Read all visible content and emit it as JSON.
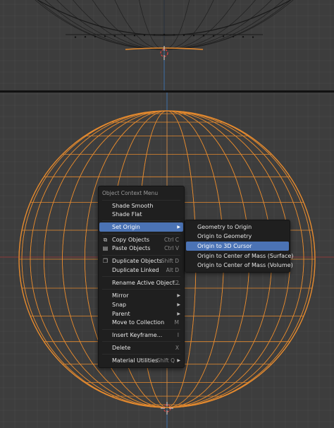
{
  "context_menu": {
    "title": "Object Context Menu",
    "items": [
      {
        "label": "Shade Smooth",
        "shortcut": ""
      },
      {
        "label": "Shade Flat",
        "shortcut": ""
      },
      {
        "label": "Set Origin",
        "shortcut": "",
        "submenu": true,
        "highlighted": true
      },
      {
        "label": "Copy Objects",
        "shortcut": "Ctrl C",
        "icon": "copy-icon"
      },
      {
        "label": "Paste Objects",
        "shortcut": "Ctrl V",
        "icon": "paste-icon"
      },
      {
        "label": "Duplicate Objects",
        "shortcut": "Shift D",
        "icon": "duplicate-icon"
      },
      {
        "label": "Duplicate Linked",
        "shortcut": "Alt D"
      },
      {
        "label": "Rename Active Object...",
        "shortcut": "F2"
      },
      {
        "label": "Mirror",
        "shortcut": "",
        "submenu": true
      },
      {
        "label": "Snap",
        "shortcut": "",
        "submenu": true
      },
      {
        "label": "Parent",
        "shortcut": "",
        "submenu": true
      },
      {
        "label": "Move to Collection",
        "shortcut": "M"
      },
      {
        "label": "Insert Keyframe...",
        "shortcut": "I"
      },
      {
        "label": "Delete",
        "shortcut": "X"
      },
      {
        "label": "Material Utilities",
        "shortcut": "Shift Q",
        "submenu": true
      }
    ]
  },
  "set_origin_submenu": {
    "items": [
      {
        "label": "Geometry to Origin"
      },
      {
        "label": "Origin to Geometry"
      },
      {
        "label": "Origin to 3D Cursor",
        "highlighted": true
      },
      {
        "label": "Origin to Center of Mass (Surface)"
      },
      {
        "label": "Origin to Center of Mass (Volume)"
      }
    ]
  },
  "colors": {
    "viewport_bg": "#3d3d3d",
    "grid": "#4a4a4a",
    "axis_blue": "#3d6ea8",
    "axis_red": "#8a3a3a",
    "selection_orange": "#e58a2e",
    "menu_bg": "#1f1f1f",
    "menu_highlight": "#4b73b5"
  }
}
